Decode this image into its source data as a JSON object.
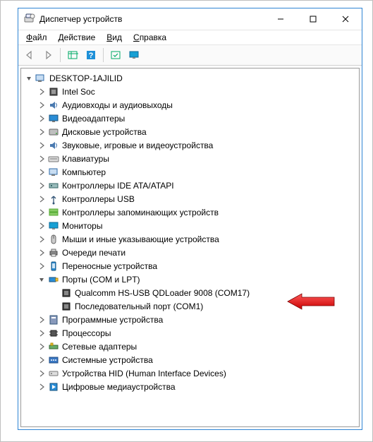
{
  "window": {
    "title": "Диспетчер устройств"
  },
  "menu": {
    "file_u": "Ф",
    "file": "айл",
    "action_u": "Д",
    "action": "ействие",
    "view_u": "В",
    "view": "ид",
    "help_u": "С",
    "help": "правка"
  },
  "tree": {
    "root": "DESKTOP-1AJILID",
    "items": [
      "Intel Soc",
      "Аудиовходы и аудиовыходы",
      "Видеоадаптеры",
      "Дисковые устройства",
      "Звуковые, игровые и видеоустройства",
      "Клавиатуры",
      "Компьютер",
      "Контроллеры IDE ATA/ATAPI",
      "Контроллеры USB",
      "Контроллеры запоминающих устройств",
      "Мониторы",
      "Мыши и иные указывающие устройства",
      "Очереди печати",
      "Переносные устройства"
    ],
    "ports_label": "Порты (COM и LPT)",
    "ports": [
      "Qualcomm HS-USB QDLoader 9008 (COM17)",
      "Последовательный порт (COM1)"
    ],
    "items2": [
      "Программные устройства",
      "Процессоры",
      "Сетевые адаптеры",
      "Системные устройства",
      "Устройства HID (Human Interface Devices)",
      "Цифровые медиаустройства"
    ]
  }
}
